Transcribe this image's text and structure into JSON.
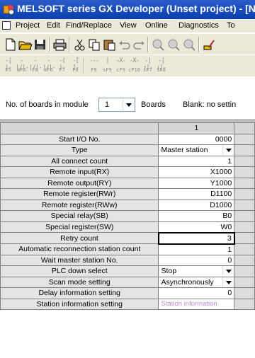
{
  "window": {
    "title": "MELSOFT series GX Developer (Unset project) - [N"
  },
  "menu": {
    "items": [
      "Project",
      "Edit",
      "Find/Replace",
      "View",
      "Online",
      "Diagnostics",
      "To"
    ]
  },
  "toolbar": {
    "icons": [
      "new-file-icon",
      "open-folder-icon",
      "save-icon",
      "print-icon",
      "cut-icon",
      "copy-icon",
      "paste-icon",
      "undo-icon",
      "redo-icon",
      "device-search-icon",
      "instruction-search-icon",
      "comment-search-icon",
      "ladder-write-icon"
    ]
  },
  "ladder_toolbar": {
    "keys": [
      {
        "symbol": "-| |-",
        "label": "F5"
      },
      {
        "symbol": "-|/|-",
        "label": "sF5"
      },
      {
        "symbol": "-|/|-",
        "label": "F6"
      },
      {
        "symbol": "-|/|-",
        "label": "sF6"
      },
      {
        "symbol": "-( )-",
        "label": "F7"
      },
      {
        "symbol": "-[ ]-",
        "label": "F8"
      },
      {
        "symbol": "---",
        "label": "F9"
      },
      {
        "symbol": " | ",
        "label": "sF9"
      },
      {
        "symbol": "-X-",
        "label": "cF9"
      },
      {
        "symbol": "-X-",
        "label": "cF10"
      },
      {
        "symbol": "-|↑|-",
        "label": "sF7"
      },
      {
        "symbol": "-|↓|-",
        "label": "sF8"
      }
    ]
  },
  "boards": {
    "label": "No. of boards in module",
    "value": "1",
    "unit": "Boards",
    "blank_note": "Blank: no settin"
  },
  "grid": {
    "column_header": "1",
    "rows": [
      {
        "label": "Start I/O No.",
        "value": "0000",
        "type": "input"
      },
      {
        "label": "Type",
        "value": "Master station",
        "type": "select"
      },
      {
        "label": "All connect count",
        "value": "1",
        "type": "input"
      },
      {
        "label": "Remote input(RX)",
        "value": "X1000",
        "type": "input"
      },
      {
        "label": "Remote output(RY)",
        "value": "Y1000",
        "type": "input"
      },
      {
        "label": "Remote register(RWr)",
        "value": "D1100",
        "type": "input"
      },
      {
        "label": "Remote register(RWw)",
        "value": "D1000",
        "type": "input"
      },
      {
        "label": "Special relay(SB)",
        "value": "B0",
        "type": "input"
      },
      {
        "label": "Special register(SW)",
        "value": "W0",
        "type": "input"
      },
      {
        "label": "Retry count",
        "value": "3",
        "type": "input",
        "focused": true
      },
      {
        "label": "Automatic reconnection station count",
        "value": "1",
        "type": "input"
      },
      {
        "label": "Wait master station No.",
        "value": "0",
        "type": "input"
      },
      {
        "label": "PLC down select",
        "value": "Stop",
        "type": "select"
      },
      {
        "label": "Scan mode setting",
        "value": "Asynchronously",
        "type": "select"
      },
      {
        "label": "Delay information setting",
        "value": "0",
        "type": "input"
      },
      {
        "label": "Station information setting",
        "value": "Station information",
        "type": "link"
      }
    ]
  },
  "colors": {
    "title_bar": "#0a3fb0",
    "chrome": "#ece9d8",
    "row_header": "#e4e4e4",
    "link_text": "#c08ad0"
  }
}
